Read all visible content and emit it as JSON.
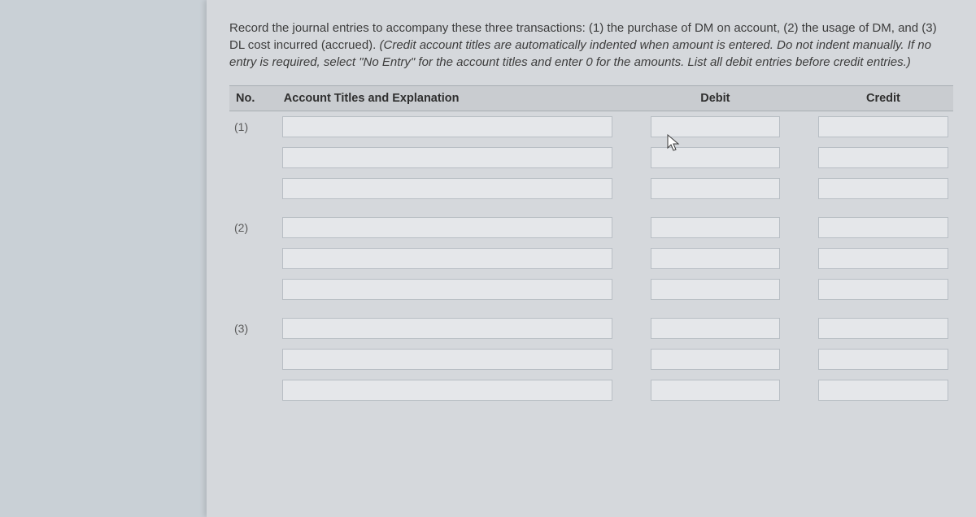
{
  "prompt": {
    "main": "Record the journal entries to accompany these three transactions: (1) the purchase of DM on account, (2) the usage of DM, and (3) DL cost incurred (accrued). ",
    "italic": "(Credit account titles are automatically indented when amount is entered. Do not indent manually. If no entry is required, select \"No Entry\" for the account titles and enter 0 for the amounts. List all debit entries before credit entries.)"
  },
  "headers": {
    "no": "No.",
    "acct": "Account Titles and Explanation",
    "debit": "Debit",
    "credit": "Credit"
  },
  "groups": [
    {
      "no": "(1)",
      "rows": 3
    },
    {
      "no": "(2)",
      "rows": 3
    },
    {
      "no": "(3)",
      "rows": 3
    }
  ]
}
